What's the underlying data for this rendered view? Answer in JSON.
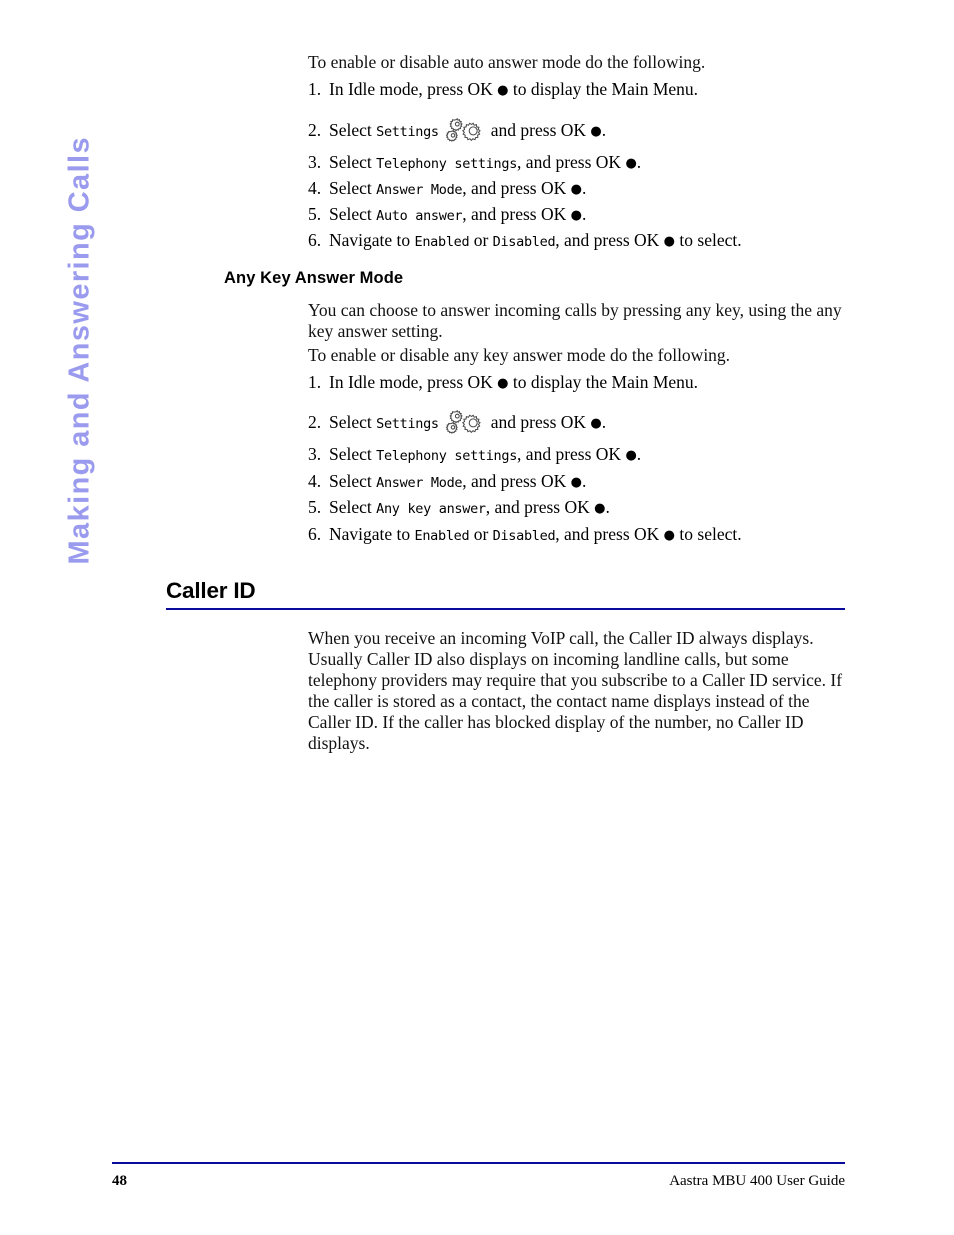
{
  "running_head": "Making and Answering Calls",
  "accent_colors": {
    "running_head": "#9a9aee",
    "rule": "#0a0a9c"
  },
  "auto_answer": {
    "intro": "To enable or disable auto answer mode do the following.",
    "steps": [
      {
        "num": "1.",
        "before": "In Idle mode, press OK ",
        "dot": "●",
        "after": " to display the Main Menu."
      },
      {
        "num": "2.",
        "before": "Select ",
        "lcd": "Settings",
        "icon": "gear-icon",
        "mid": "and press OK ",
        "dot": "●",
        "after": "."
      },
      {
        "num": "3.",
        "before": "Select ",
        "lcd": "Telephony settings",
        "mid": ", and press OK ",
        "dot": "●",
        "after": "."
      },
      {
        "num": "4.",
        "before": "Select ",
        "lcd": "Answer Mode",
        "mid": ", and press OK ",
        "dot": "●",
        "after": "."
      },
      {
        "num": "5.",
        "before": "Select ",
        "lcd": "Auto answer",
        "mid": ", and press OK ",
        "dot": "●",
        "after": "."
      },
      {
        "num": "6.",
        "before": "Navigate to ",
        "lcd": "Enabled",
        "mid": " or ",
        "lcd2": "Disabled",
        "mid2": ", and press OK ",
        "dot": "●",
        "after": " to select."
      }
    ]
  },
  "any_key": {
    "heading": "Any Key Answer Mode",
    "para1": "You can choose to answer incoming calls by pressing any key, using the any key answer setting.",
    "para2": "To enable or disable any key answer mode do the following.",
    "steps": [
      {
        "num": "1.",
        "before": "In Idle mode, press OK ",
        "dot": "●",
        "after": " to display the Main Menu."
      },
      {
        "num": "2.",
        "before": "Select ",
        "lcd": "Settings",
        "icon": "gear-icon",
        "mid": "and press OK ",
        "dot": "●",
        "after": "."
      },
      {
        "num": "3.",
        "before": "Select ",
        "lcd": "Telephony settings",
        "mid": ", and press OK ",
        "dot": "●",
        "after": "."
      },
      {
        "num": "4.",
        "before": "Select ",
        "lcd": "Answer Mode",
        "mid": ", and press OK ",
        "dot": "●",
        "after": "."
      },
      {
        "num": "5.",
        "before": "Select ",
        "lcd": "Any key answer",
        "mid": ", and press OK ",
        "dot": "●",
        "after": "."
      },
      {
        "num": "6.",
        "before": "Navigate to ",
        "lcd": "Enabled",
        "mid": " or ",
        "lcd2": "Disabled",
        "mid2": ", and press OK ",
        "dot": "●",
        "after": " to select."
      }
    ]
  },
  "caller_id": {
    "heading": "Caller ID",
    "para": "When you receive an incoming VoIP call, the Caller ID always displays. Usually Caller ID also displays on incoming landline calls, but some telephony providers may require that you subscribe to a Caller ID service. If the caller is stored as a contact, the contact name displays instead of the Caller ID. If the caller has blocked display of the number, no Caller ID displays."
  },
  "footer": {
    "page_number": "48",
    "guide_title": "Aastra MBU 400 User Guide"
  }
}
